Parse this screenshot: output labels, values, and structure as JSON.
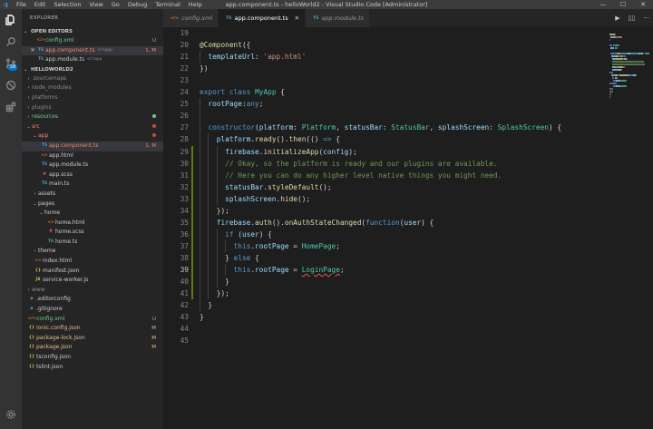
{
  "window": {
    "title": "app.component.ts - helloWorld2 - Visual Studio Code [Administrator]",
    "menu": [
      "File",
      "Edit",
      "Selection",
      "View",
      "Go",
      "Debug",
      "Terminal",
      "Help"
    ],
    "controls": [
      "—",
      "☐",
      "✕"
    ]
  },
  "activity": {
    "scm_badge": "58"
  },
  "sidebar": {
    "title": "EXPLORER",
    "open_editors_label": "OPEN EDITORS",
    "project_label": "HELLOWORLD2",
    "open_editors": [
      {
        "icon": "XML",
        "label": "config.xml",
        "desc": "",
        "badge": "U",
        "status": "add"
      },
      {
        "icon": "TS",
        "label": "app.component.ts",
        "desc": "src\\app",
        "badge": "1, M",
        "status": "err",
        "selected": true
      },
      {
        "icon": "TS",
        "label": "app.module.ts",
        "desc": "src\\app",
        "badge": "",
        "status": "def"
      }
    ],
    "tree": [
      {
        "depth": 0,
        "chev": "›",
        "icon": "",
        "label": ".sourcemaps",
        "badge": "",
        "status": "ign"
      },
      {
        "depth": 0,
        "chev": "›",
        "icon": "",
        "label": "node_modules",
        "badge": "",
        "status": "ign"
      },
      {
        "depth": 0,
        "chev": "›",
        "icon": "",
        "label": "platforms",
        "badge": "",
        "status": "ign"
      },
      {
        "depth": 0,
        "chev": "›",
        "icon": "",
        "label": "plugins",
        "badge": "",
        "status": "ign"
      },
      {
        "depth": 0,
        "chev": "›",
        "icon": "",
        "label": "resources",
        "badge": "dot",
        "status": "add"
      },
      {
        "depth": 0,
        "chev": "⌄",
        "icon": "",
        "label": "src",
        "badge": "dot",
        "status": "err"
      },
      {
        "depth": 1,
        "chev": "⌄",
        "icon": "",
        "label": "app",
        "badge": "dot",
        "status": "err"
      },
      {
        "depth": 2,
        "chev": "",
        "icon": "TS",
        "label": "app.component.ts",
        "badge": "1, M",
        "status": "err",
        "selected": true
      },
      {
        "depth": 2,
        "chev": "",
        "icon": "<>",
        "label": "app.html",
        "badge": "",
        "status": "def"
      },
      {
        "depth": 2,
        "chev": "",
        "icon": "TS",
        "label": "app.module.ts",
        "badge": "",
        "status": "def"
      },
      {
        "depth": 2,
        "chev": "",
        "icon": "#",
        "label": "app.scss",
        "badge": "",
        "status": "def"
      },
      {
        "depth": 2,
        "chev": "",
        "icon": "TS",
        "label": "main.ts",
        "badge": "",
        "status": "def"
      },
      {
        "depth": 1,
        "chev": "›",
        "icon": "",
        "label": "assets",
        "badge": "",
        "status": "def"
      },
      {
        "depth": 1,
        "chev": "⌄",
        "icon": "",
        "label": "pages",
        "badge": "",
        "status": "def"
      },
      {
        "depth": 2,
        "chev": "⌄",
        "icon": "",
        "label": "home",
        "badge": "",
        "status": "def"
      },
      {
        "depth": 3,
        "chev": "",
        "icon": "<>",
        "label": "home.html",
        "badge": "",
        "status": "def"
      },
      {
        "depth": 3,
        "chev": "",
        "icon": "#",
        "label": "home.scss",
        "badge": "",
        "status": "def"
      },
      {
        "depth": 3,
        "chev": "",
        "icon": "TS",
        "label": "home.ts",
        "badge": "",
        "status": "def"
      },
      {
        "depth": 1,
        "chev": "›",
        "icon": "",
        "label": "theme",
        "badge": "",
        "status": "def"
      },
      {
        "depth": 1,
        "chev": "",
        "icon": "<>",
        "label": "index.html",
        "badge": "",
        "status": "def"
      },
      {
        "depth": 1,
        "chev": "",
        "icon": "{}",
        "label": "manifest.json",
        "badge": "",
        "status": "def"
      },
      {
        "depth": 1,
        "chev": "",
        "icon": "JS",
        "label": "service-worker.js",
        "badge": "",
        "status": "def"
      },
      {
        "depth": 0,
        "chev": "›",
        "icon": "",
        "label": "www",
        "badge": "",
        "status": "ign"
      },
      {
        "depth": 0,
        "chev": "",
        "icon": "◆",
        "label": ".editorconfig",
        "badge": "",
        "status": "def"
      },
      {
        "depth": 0,
        "chev": "",
        "icon": "◆",
        "label": ".gitignore",
        "badge": "",
        "status": "def"
      },
      {
        "depth": 0,
        "chev": "",
        "icon": "XML",
        "label": "config.xml",
        "badge": "U",
        "status": "add"
      },
      {
        "depth": 0,
        "chev": "",
        "icon": "{}",
        "label": "ionic.config.json",
        "badge": "M",
        "status": "mod"
      },
      {
        "depth": 0,
        "chev": "",
        "icon": "{}",
        "label": "package-lock.json",
        "badge": "M",
        "status": "mod"
      },
      {
        "depth": 0,
        "chev": "",
        "icon": "{}",
        "label": "package.json",
        "badge": "M",
        "status": "mod"
      },
      {
        "depth": 0,
        "chev": "",
        "icon": "{}",
        "label": "tsconfig.json",
        "badge": "",
        "status": "def"
      },
      {
        "depth": 0,
        "chev": "",
        "icon": "{}",
        "label": "tslint.json",
        "badge": "",
        "status": "def"
      }
    ]
  },
  "tabs": [
    {
      "icon": "XML",
      "label": "config.xml",
      "active": false,
      "italic": true
    },
    {
      "icon": "TS",
      "label": "app.component.ts",
      "active": true,
      "italic": false
    },
    {
      "icon": "TS",
      "label": "app.module.ts",
      "active": false,
      "italic": true
    }
  ],
  "editor_actions": [
    "▶",
    "▯▯",
    "···"
  ],
  "editor": {
    "current_line": 39,
    "lines": [
      {
        "n": "19",
        "tokens": []
      },
      {
        "n": "20",
        "tokens": [
          [
            "m",
            "@Component"
          ],
          [
            "p",
            "({"
          ]
        ]
      },
      {
        "n": "21",
        "tokens": [
          [
            "p",
            "  "
          ],
          [
            "v",
            "templateUrl"
          ],
          [
            "p",
            ": "
          ],
          [
            "s",
            "'app.html'"
          ]
        ]
      },
      {
        "n": "22",
        "tokens": [
          [
            "p",
            "})"
          ]
        ]
      },
      {
        "n": "23",
        "tokens": []
      },
      {
        "n": "24",
        "tokens": [
          [
            "k",
            "export"
          ],
          [
            "p",
            " "
          ],
          [
            "k",
            "class"
          ],
          [
            "p",
            " "
          ],
          [
            "c",
            "MyApp"
          ],
          [
            "p",
            " {"
          ]
        ]
      },
      {
        "n": "25",
        "tokens": [
          [
            "p",
            "  "
          ],
          [
            "v",
            "rootPage"
          ],
          [
            "p",
            ":"
          ],
          [
            "k",
            "any"
          ],
          [
            "p",
            ";"
          ]
        ]
      },
      {
        "n": "26",
        "tokens": []
      },
      {
        "n": "27",
        "tokens": [
          [
            "p",
            "  "
          ],
          [
            "k",
            "constructor"
          ],
          [
            "p",
            "("
          ],
          [
            "v",
            "platform"
          ],
          [
            "p",
            ": "
          ],
          [
            "c",
            "Platform"
          ],
          [
            "p",
            ", "
          ],
          [
            "v",
            "statusBar"
          ],
          [
            "p",
            ": "
          ],
          [
            "c",
            "StatusBar"
          ],
          [
            "p",
            ", "
          ],
          [
            "v",
            "splashScreen"
          ],
          [
            "p",
            ": "
          ],
          [
            "c",
            "SplashScreen"
          ],
          [
            "p",
            ") {"
          ]
        ]
      },
      {
        "n": "28",
        "tokens": [
          [
            "p",
            "    "
          ],
          [
            "v",
            "platform"
          ],
          [
            "p",
            "."
          ],
          [
            "m",
            "ready"
          ],
          [
            "p",
            "()."
          ],
          [
            "m",
            "then"
          ],
          [
            "p",
            "(() "
          ],
          [
            "k",
            "=>"
          ],
          [
            "p",
            " {"
          ]
        ]
      },
      {
        "n": "29",
        "tokens": [
          [
            "p",
            "      "
          ],
          [
            "v",
            "firebase"
          ],
          [
            "p",
            "."
          ],
          [
            "m",
            "initializeApp"
          ],
          [
            "p",
            "("
          ],
          [
            "v",
            "config"
          ],
          [
            "p",
            ");"
          ]
        ]
      },
      {
        "n": "30",
        "tokens": [
          [
            "p",
            "      "
          ],
          [
            "cm",
            "// Okay, so the platform is ready and our plugins are available."
          ]
        ]
      },
      {
        "n": "31",
        "tokens": [
          [
            "p",
            "      "
          ],
          [
            "cm",
            "// Here you can do any higher level native things you might need."
          ]
        ]
      },
      {
        "n": "32",
        "tokens": [
          [
            "p",
            "      "
          ],
          [
            "v",
            "statusBar"
          ],
          [
            "p",
            "."
          ],
          [
            "m",
            "styleDefault"
          ],
          [
            "p",
            "();"
          ]
        ]
      },
      {
        "n": "33",
        "tokens": [
          [
            "p",
            "      "
          ],
          [
            "v",
            "splashScreen"
          ],
          [
            "p",
            "."
          ],
          [
            "m",
            "hide"
          ],
          [
            "p",
            "();"
          ]
        ]
      },
      {
        "n": "34",
        "tokens": [
          [
            "p",
            "    });"
          ]
        ]
      },
      {
        "n": "35",
        "tokens": [
          [
            "p",
            "    "
          ],
          [
            "v",
            "firebase"
          ],
          [
            "p",
            "."
          ],
          [
            "m",
            "auth"
          ],
          [
            "p",
            "()."
          ],
          [
            "m",
            "onAuthStateChanged"
          ],
          [
            "p",
            "("
          ],
          [
            "k",
            "function"
          ],
          [
            "p",
            "("
          ],
          [
            "v",
            "user"
          ],
          [
            "p",
            ") {"
          ]
        ]
      },
      {
        "n": "36",
        "tokens": [
          [
            "p",
            "      "
          ],
          [
            "k",
            "if"
          ],
          [
            "p",
            " ("
          ],
          [
            "v",
            "user"
          ],
          [
            "p",
            ") {"
          ]
        ]
      },
      {
        "n": "37",
        "tokens": [
          [
            "p",
            "        "
          ],
          [
            "k",
            "this"
          ],
          [
            "p",
            "."
          ],
          [
            "v",
            "rootPage"
          ],
          [
            "p",
            " = "
          ],
          [
            "c",
            "HomePage"
          ],
          [
            "p",
            ";"
          ]
        ]
      },
      {
        "n": "38",
        "tokens": [
          [
            "p",
            "      } "
          ],
          [
            "k",
            "else"
          ],
          [
            "p",
            " {"
          ]
        ]
      },
      {
        "n": "39",
        "tokens": [
          [
            "p",
            "        "
          ],
          [
            "k",
            "this"
          ],
          [
            "p",
            "."
          ],
          [
            "v",
            "rootPage"
          ],
          [
            "p",
            " = "
          ],
          [
            "cerr",
            "LoginPage"
          ],
          [
            "p",
            ";"
          ]
        ]
      },
      {
        "n": "40",
        "tokens": [
          [
            "p",
            "      }"
          ]
        ]
      },
      {
        "n": "41",
        "tokens": [
          [
            "p",
            "    });"
          ]
        ]
      },
      {
        "n": "42",
        "tokens": [
          [
            "p",
            "  }"
          ]
        ]
      },
      {
        "n": "43",
        "tokens": [
          [
            "p",
            "}"
          ]
        ]
      },
      {
        "n": "44",
        "tokens": []
      },
      {
        "n": "45",
        "tokens": []
      }
    ],
    "modified_lines": [
      "29",
      "30",
      "31",
      "32",
      "33",
      "34",
      "35",
      "36",
      "37",
      "38",
      "39",
      "40",
      "41"
    ]
  }
}
